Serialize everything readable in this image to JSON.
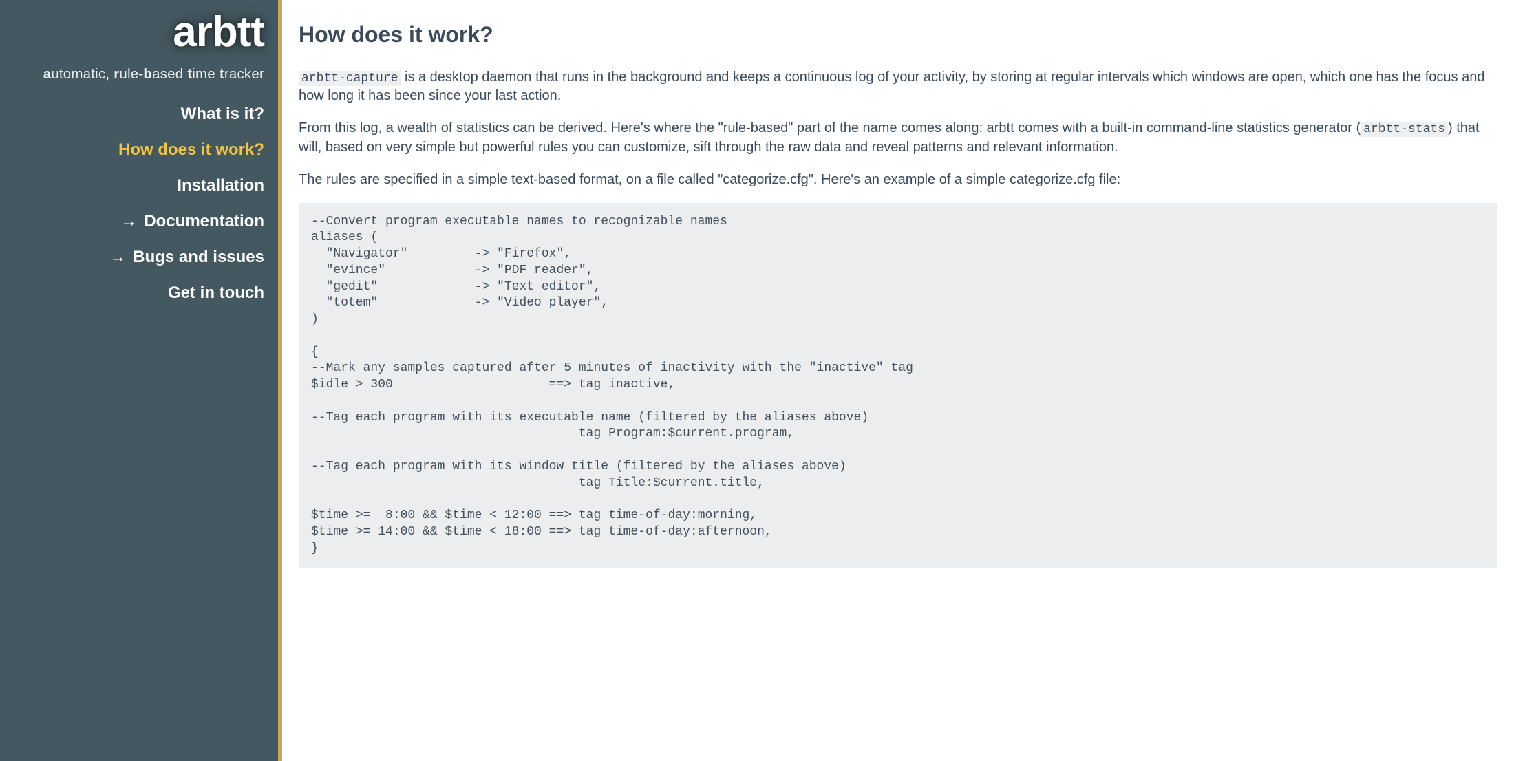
{
  "site": {
    "logo": "arbtt",
    "tagline_parts": [
      "a",
      "utomatic, ",
      "r",
      "ule-",
      "b",
      "ased ",
      "t",
      "ime ",
      "t",
      "racker"
    ]
  },
  "nav": {
    "items": [
      {
        "label": "What is it?",
        "external": false,
        "active": false
      },
      {
        "label": "How does it work?",
        "external": false,
        "active": true
      },
      {
        "label": "Installation",
        "external": false,
        "active": false
      },
      {
        "label": "Documentation",
        "external": true,
        "active": false
      },
      {
        "label": "Bugs and issues",
        "external": true,
        "active": false
      },
      {
        "label": "Get in touch",
        "external": false,
        "active": false
      }
    ]
  },
  "page": {
    "title": "How does it work?",
    "code_inline_1": "arbtt-capture",
    "para1_rest": " is a desktop daemon that runs in the background and keeps a continuous log of your activity, by storing at regular intervals which windows are open, which one has the focus and how long it has been since your last action.",
    "para2_before": "From this log, a wealth of statistics can be derived. Here's where the \"rule-based\" part of the name comes along: arbtt comes with a built-in command-line statistics generator (",
    "code_inline_2": "arbtt-stats",
    "para2_after": ") that will, based on very simple but powerful rules you can customize, sift through the raw data and reveal patterns and relevant information.",
    "para3": "The rules are specified in a simple text-based format, on a file called \"categorize.cfg\". Here's an example of a simple categorize.cfg file:",
    "code_block": "--Convert program executable names to recognizable names\naliases (\n  \"Navigator\"         -> \"Firefox\",\n  \"evince\"            -> \"PDF reader\",\n  \"gedit\"             -> \"Text editor\",\n  \"totem\"             -> \"Video player\",\n)\n\n{\n--Mark any samples captured after 5 minutes of inactivity with the \"inactive\" tag\n$idle > 300                     ==> tag inactive,\n\n--Tag each program with its executable name (filtered by the aliases above)\n                                    tag Program:$current.program,\n\n--Tag each program with its window title (filtered by the aliases above)\n                                    tag Title:$current.title,\n\n$time >=  8:00 && $time < 12:00 ==> tag time-of-day:morning,\n$time >= 14:00 && $time < 18:00 ==> tag time-of-day:afternoon,\n}"
  }
}
